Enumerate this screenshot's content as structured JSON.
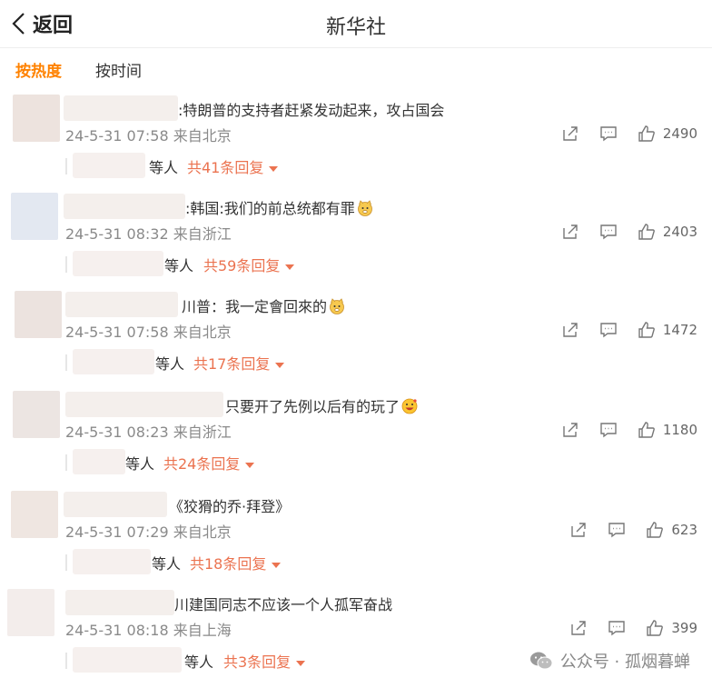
{
  "header": {
    "back_label": "返回",
    "title": "新华社"
  },
  "sort_tabs": [
    {
      "label": "按热度",
      "active": true
    },
    {
      "label": "按时间",
      "active": false
    }
  ],
  "comments": [
    {
      "text": ":特朗普的支持者赶紧发动起来，攻占国会",
      "emoji": "",
      "meta": "24-5-31 07:58 来自北京",
      "likes": "2490",
      "reply_etc": "等人",
      "reply_count": "共41条回复"
    },
    {
      "text": ":韩国:我们的前总统都有罪",
      "emoji": "doge-face",
      "meta": "24-5-31 08:32 来自浙江",
      "likes": "2403",
      "reply_etc": "等人",
      "reply_count": "共59条回复"
    },
    {
      "text": "川普：我一定會回來的",
      "emoji": "doge-face",
      "meta": "24-5-31 07:58 来自北京",
      "likes": "1472",
      "reply_etc": "等人",
      "reply_count": "共17条回复"
    },
    {
      "text": "只要开了先例以后有的玩了",
      "emoji": "grin-face",
      "meta": "24-5-31 08:23 来自浙江",
      "likes": "1180",
      "reply_etc": "等人",
      "reply_count": "共24条回复"
    },
    {
      "text": "《狡猾的乔·拜登》",
      "emoji": "",
      "meta": "24-5-31 07:29 来自北京",
      "likes": "623",
      "reply_etc": "等人",
      "reply_count": "共18条回复"
    },
    {
      "text": "川建国同志不应该一个人孤军奋战",
      "emoji": "",
      "meta": "24-5-31 08:18 来自上海",
      "likes": "399",
      "reply_etc": "等人",
      "reply_count": "共3条回复"
    }
  ],
  "watermark": {
    "text": "公众号 · 孤烟暮蝉"
  },
  "colors": {
    "accent": "#ff8200",
    "reply_link": "#eb7350",
    "meta_gray": "#8a8a8a"
  }
}
